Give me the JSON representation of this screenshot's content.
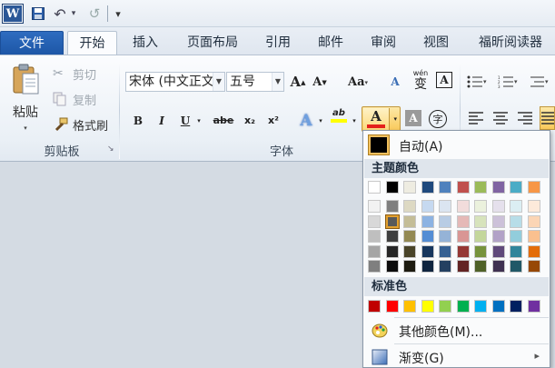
{
  "qat": {
    "logo": "W",
    "undo_arrow": "↶",
    "redo_arrow": "↺",
    "customize": "▾"
  },
  "tabs": [
    {
      "label": "文件"
    },
    {
      "label": "开始"
    },
    {
      "label": "插入"
    },
    {
      "label": "页面布局"
    },
    {
      "label": "引用"
    },
    {
      "label": "邮件"
    },
    {
      "label": "审阅"
    },
    {
      "label": "视图"
    },
    {
      "label": "福昕阅读器"
    }
  ],
  "clipboard": {
    "paste": "粘贴",
    "cut": "剪切",
    "copy": "复制",
    "format_painter": "格式刷",
    "group_label": "剪贴板"
  },
  "font": {
    "font_name": "宋体 (中文正文)",
    "font_size": "五号",
    "grow": "A",
    "shrink": "A",
    "change_case": "Aa",
    "clear": "A",
    "pinyin": "wén",
    "pinyin_char": "变",
    "border_char": "A",
    "bold": "B",
    "italic": "I",
    "underline": "U",
    "strike": "abe",
    "sub": "x₂",
    "sup": "x²",
    "text_effect": "A",
    "highlight": "ab",
    "font_color": "A",
    "shading": "A",
    "enclose": "字",
    "group_label": "字体"
  },
  "colors": {
    "accent_red": "#e4211b",
    "highlight_yellow": "#ffff00",
    "file_tab": "#2a62b2",
    "theme_top": [
      "#ffffff",
      "#000000",
      "#eeece1",
      "#1f497d",
      "#4f81bd",
      "#c0504d",
      "#9bbb59",
      "#8064a2",
      "#4bacc6",
      "#f79646"
    ],
    "theme_shades": [
      [
        "#f2f2f2",
        "#7f7f7f",
        "#ddd9c3",
        "#c6d9f0",
        "#dbe5f1",
        "#f2dcdb",
        "#ebf1dd",
        "#e5e0ec",
        "#dbeef3",
        "#fdeada"
      ],
      [
        "#d8d8d8",
        "#595959",
        "#c4bd97",
        "#8db3e2",
        "#b8cce4",
        "#e5b9b7",
        "#d7e3bc",
        "#ccc1d9",
        "#b7dde8",
        "#fbd5b5"
      ],
      [
        "#bfbfbf",
        "#3f3f3f",
        "#938953",
        "#548dd4",
        "#95b3d7",
        "#d99694",
        "#c3d69b",
        "#b2a2c7",
        "#92cddc",
        "#fac08f"
      ],
      [
        "#a5a5a5",
        "#262626",
        "#494429",
        "#17365d",
        "#366092",
        "#953734",
        "#76923c",
        "#5f497a",
        "#31859b",
        "#e36c09"
      ],
      [
        "#7f7f7f",
        "#0c0c0c",
        "#1d1b10",
        "#0f243e",
        "#244061",
        "#632423",
        "#4f6128",
        "#3f3151",
        "#205867",
        "#974806"
      ]
    ],
    "standard": [
      "#c00000",
      "#ff0000",
      "#ffc000",
      "#ffff00",
      "#92d050",
      "#00b050",
      "#00b0f0",
      "#0070c0",
      "#002060",
      "#7030a0"
    ]
  },
  "popup": {
    "auto_label": "自动(A)",
    "theme_header": "主题颜色",
    "standard_header": "标准色",
    "more_colors": "其他颜色(M)...",
    "gradient": "渐变(G)",
    "submenu_arrow": "▸"
  }
}
